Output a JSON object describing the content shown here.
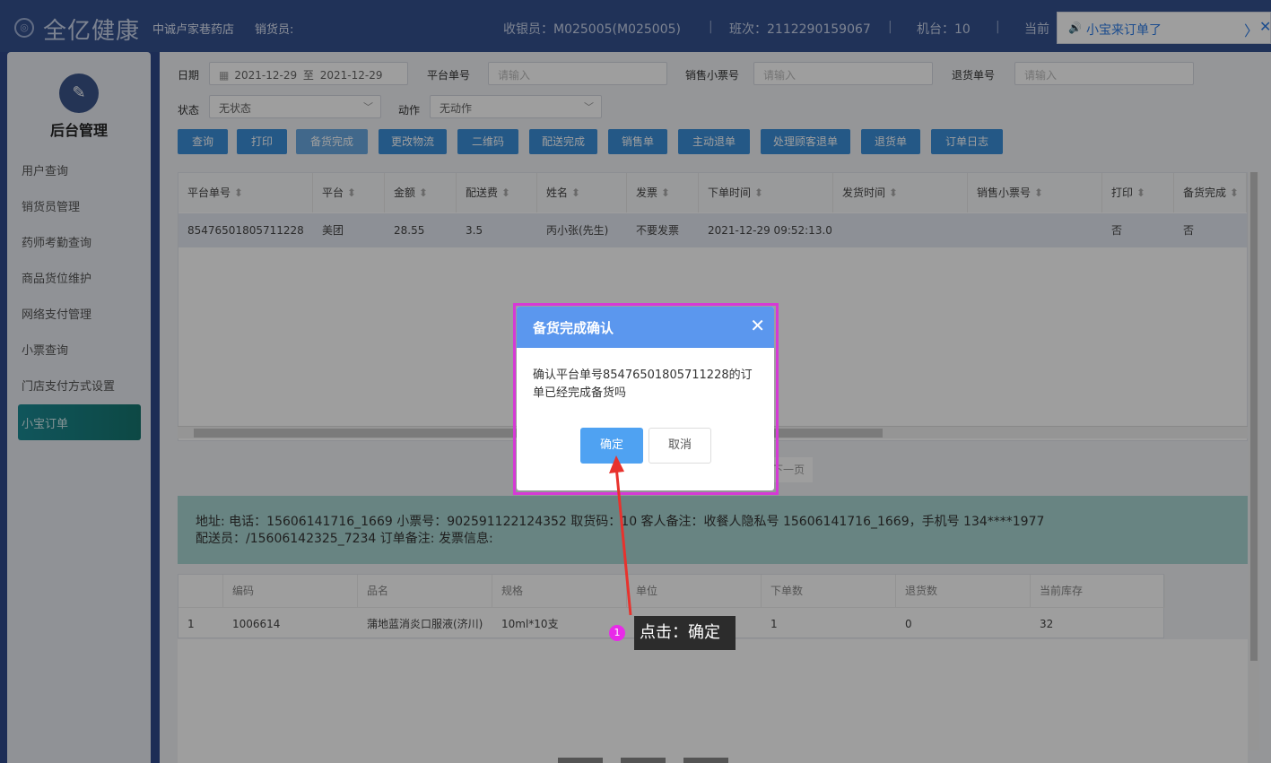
{
  "header": {
    "logo_glyph": "◎",
    "brand": "全亿健康",
    "store": "中诚卢家巷药店",
    "seller": "销货员:",
    "cashier": "收银员：M025005(M025005)",
    "shift": "班次：2112290159067",
    "machine": "机台：10",
    "current": "当前",
    "separator": "|",
    "notify_icon": "🔊",
    "notify_text": "小宝来订单了",
    "notify_arrow": "〉",
    "notify_close": "✕"
  },
  "sidebar": {
    "admin_title": "后台管理",
    "admin_icon": "✎",
    "items": [
      "用户查询",
      "销货员管理",
      "药师考勤查询",
      "商品货位维护",
      "网络支付管理",
      "小票查询",
      "门店支付方式设置"
    ],
    "active": "小宝订单"
  },
  "filters": {
    "date_label": "日期",
    "date_start": "2021-12-29",
    "date_to": "至",
    "date_end": "2021-12-29",
    "platform_no_label": "平台单号",
    "platform_no_placeholder": "请输入",
    "receipt_label": "销售小票号",
    "receipt_placeholder": "请输入",
    "return_label": "退货单号",
    "return_placeholder": "请输入",
    "status_label": "状态",
    "status_value": "无状态",
    "action_label": "动作",
    "action_value": "无动作",
    "calendar_icon": "▦",
    "chevron": "﹀"
  },
  "buttons": [
    "查询",
    "打印",
    "备货完成",
    "更改物流",
    "二维码",
    "配送完成",
    "销售单",
    "主动退单",
    "处理顾客退单",
    "退货单",
    "订单日志"
  ],
  "orders": {
    "sort_icon": "⬍",
    "columns": [
      "平台单号",
      "平台",
      "金额",
      "配送费",
      "姓名",
      "发票",
      "下单时间",
      "发货时间",
      "销售小票号",
      "打印",
      "备货完成"
    ],
    "row": [
      "85476501805711228",
      "美团",
      "28.55",
      "3.5",
      "丙小张(先生)",
      "不要发票",
      "2021-12-29 09:52:13.0",
      "",
      "",
      "否",
      "否"
    ]
  },
  "pagination": {
    "next": "下一页"
  },
  "info": {
    "line1": "地址:    电话：15606141716_1669   小票号：902591122124352   取货码：10   客人备注：收餐人隐私号 15606141716_1669，手机号 134****1977",
    "line2": "配送员：/15606142325_7234   订单备注:    发票信息:"
  },
  "items_table": {
    "columns": [
      "",
      "编码",
      "品名",
      "规格",
      "单位",
      "下单数",
      "退货数",
      "当前库存"
    ],
    "row": [
      "1",
      "1006614",
      "蒲地蓝消炎口服液(济川)",
      "10ml*10支",
      "",
      "1",
      "0",
      "32"
    ]
  },
  "dialog": {
    "title": "备货完成确认",
    "close": "✕",
    "message": "确认平台单号85476501805711228的订单已经完成备货吗",
    "ok": "确定",
    "cancel": "取消"
  },
  "annotation": {
    "step": "1",
    "text": "点击：确定"
  }
}
